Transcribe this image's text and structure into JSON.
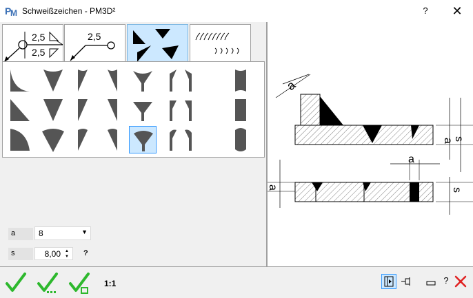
{
  "window": {
    "title": "Schweißzeichen - PM3D²",
    "help_label": "?",
    "close_label": "✕"
  },
  "tabs": [
    {
      "name": "symbol-reference",
      "label_top": "2,5",
      "label_bottom": "2,5"
    },
    {
      "name": "symbol-simple",
      "label_top": "2,5"
    },
    {
      "name": "weld-shapes",
      "active": true
    },
    {
      "name": "weld-marks"
    }
  ],
  "params": {
    "a_label": "a",
    "a_value": "8",
    "s_label": "s",
    "s_value": "8,00",
    "help": "?"
  },
  "bottom": {
    "scale": "1:1"
  },
  "preview": {
    "a_label": "a",
    "s_label": "s"
  },
  "colors": {
    "accent": "#3399ff",
    "selection_bg": "#cce8ff",
    "check_green": "#2db82d",
    "cancel_red": "#e02020"
  }
}
